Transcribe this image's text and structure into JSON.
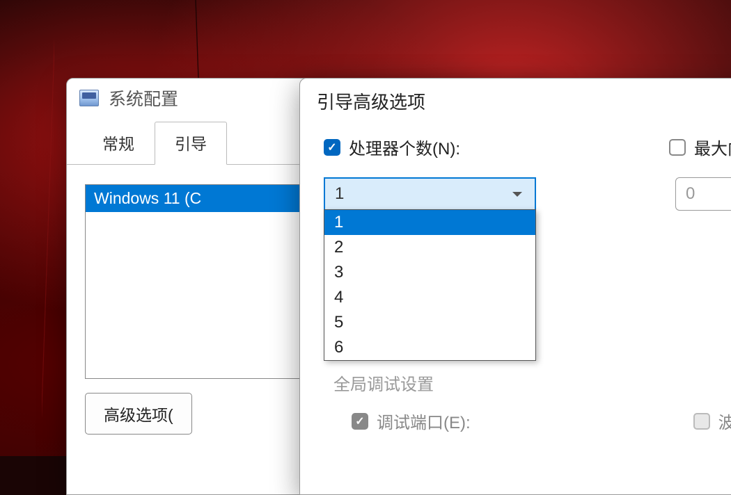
{
  "main_window": {
    "title": "系统配置",
    "tabs": [
      {
        "label": "常规",
        "active": false
      },
      {
        "label": "引导",
        "active": true
      }
    ],
    "os_list": [
      "Windows 11 (C"
    ],
    "advanced_button": "高级选项("
  },
  "advanced_window": {
    "title": "引导高级选项",
    "processor_count": {
      "label": "处理器个数(N):",
      "checked": true,
      "selected": "1",
      "options": [
        "1",
        "2",
        "3",
        "4",
        "5",
        "6"
      ]
    },
    "max_memory": {
      "label": "最大内",
      "checked": false,
      "value": "0"
    },
    "global_debug": {
      "label": "全局调试设置",
      "debug_port": {
        "label": "调试端口(E):",
        "checked": true
      },
      "baud_rate": {
        "label": "波特率(",
        "checked": false
      }
    }
  }
}
